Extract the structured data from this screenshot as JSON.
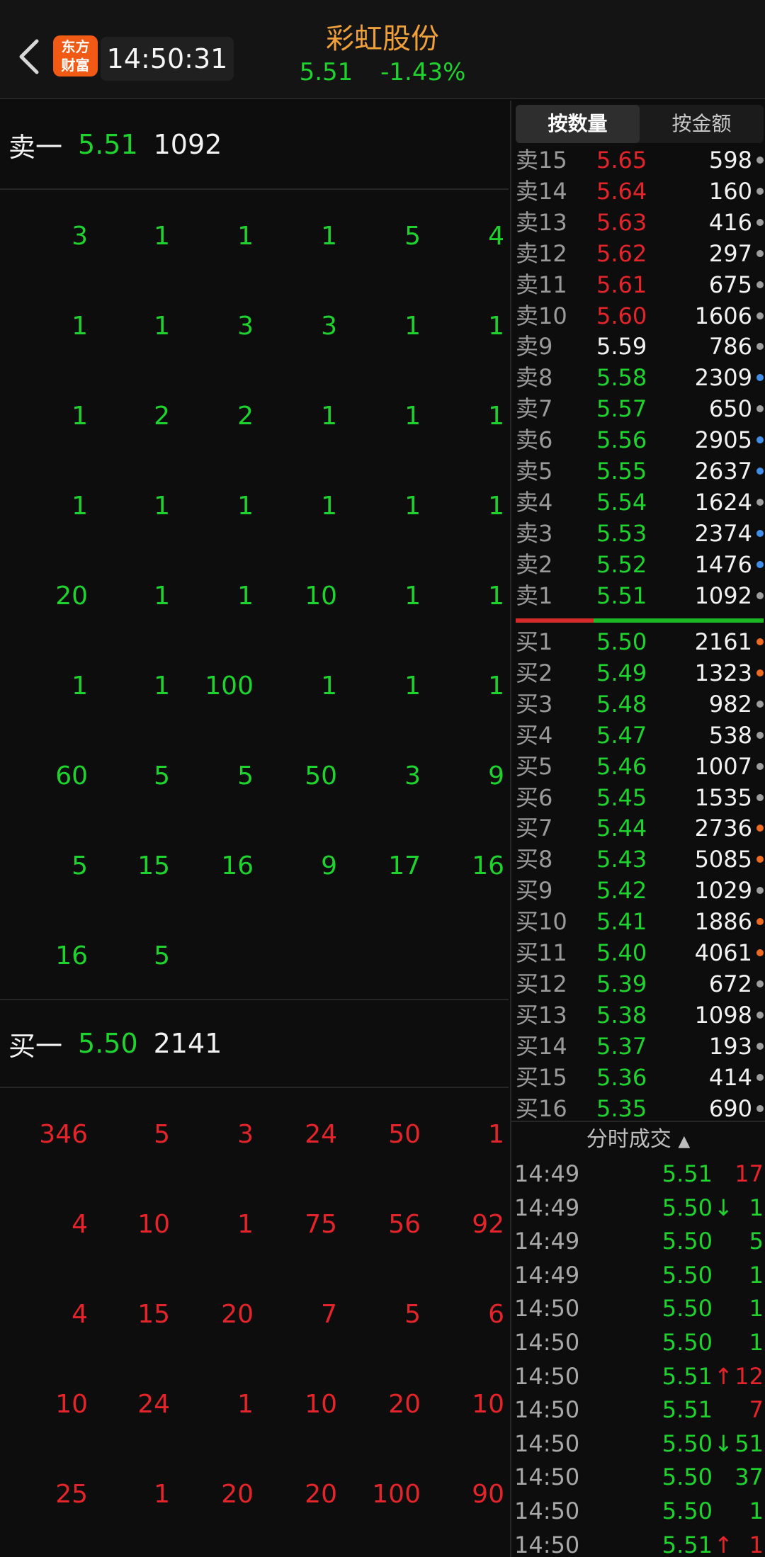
{
  "header": {
    "back_icon": "chevron-left-icon",
    "logo_line1": "东方",
    "logo_line2": "财富",
    "time": "14:50:31",
    "title": "彩虹股份",
    "price": "5.51",
    "change": "-1.43%"
  },
  "sell_queue": {
    "label": "卖一",
    "price": "5.51",
    "volume": "1092",
    "rows": [
      [
        "3",
        "1",
        "1",
        "1",
        "5",
        "4"
      ],
      [
        "1",
        "1",
        "3",
        "3",
        "1",
        "1"
      ],
      [
        "1",
        "2",
        "2",
        "1",
        "1",
        "1"
      ],
      [
        "1",
        "1",
        "1",
        "1",
        "1",
        "1"
      ],
      [
        "20",
        "1",
        "1",
        "10",
        "1",
        "1"
      ],
      [
        "1",
        "1",
        "100",
        "1",
        "1",
        "1"
      ],
      [
        "60",
        "5",
        "5",
        "50",
        "3",
        "9"
      ],
      [
        "5",
        "15",
        "16",
        "9",
        "17",
        "16"
      ],
      [
        "16",
        "5"
      ]
    ]
  },
  "buy_queue": {
    "label": "买一",
    "price": "5.50",
    "volume": "2141",
    "rows": [
      [
        "346",
        "5",
        "3",
        "24",
        "50",
        "1"
      ],
      [
        "4",
        "10",
        "1",
        "75",
        "56",
        "92"
      ],
      [
        "4",
        "15",
        "20",
        "7",
        "5",
        "6"
      ],
      [
        "10",
        "24",
        "1",
        "10",
        "20",
        "10"
      ],
      [
        "25",
        "1",
        "20",
        "20",
        "100",
        "90"
      ]
    ]
  },
  "tabs": [
    "按数量",
    "按金额"
  ],
  "sell_book": [
    {
      "label": "卖15",
      "price": "5.65",
      "vol": "598",
      "color": "red",
      "dot": "gray"
    },
    {
      "label": "卖14",
      "price": "5.64",
      "vol": "160",
      "color": "red",
      "dot": "gray"
    },
    {
      "label": "卖13",
      "price": "5.63",
      "vol": "416",
      "color": "red",
      "dot": "gray"
    },
    {
      "label": "卖12",
      "price": "5.62",
      "vol": "297",
      "color": "red",
      "dot": "gray"
    },
    {
      "label": "卖11",
      "price": "5.61",
      "vol": "675",
      "color": "red",
      "dot": "gray"
    },
    {
      "label": "卖10",
      "price": "5.60",
      "vol": "1606",
      "color": "red",
      "dot": "gray"
    },
    {
      "label": "卖9",
      "price": "5.59",
      "vol": "786",
      "color": "white",
      "dot": "gray"
    },
    {
      "label": "卖8",
      "price": "5.58",
      "vol": "2309",
      "color": "green",
      "dot": "blue"
    },
    {
      "label": "卖7",
      "price": "5.57",
      "vol": "650",
      "color": "green",
      "dot": "gray"
    },
    {
      "label": "卖6",
      "price": "5.56",
      "vol": "2905",
      "color": "green",
      "dot": "blue"
    },
    {
      "label": "卖5",
      "price": "5.55",
      "vol": "2637",
      "color": "green",
      "dot": "blue"
    },
    {
      "label": "卖4",
      "price": "5.54",
      "vol": "1624",
      "color": "green",
      "dot": "gray"
    },
    {
      "label": "卖3",
      "price": "5.53",
      "vol": "2374",
      "color": "green",
      "dot": "blue"
    },
    {
      "label": "卖2",
      "price": "5.52",
      "vol": "1476",
      "color": "green",
      "dot": "blue"
    },
    {
      "label": "卖1",
      "price": "5.51",
      "vol": "1092",
      "color": "green",
      "dot": "gray"
    }
  ],
  "buy_book": [
    {
      "label": "买1",
      "price": "5.50",
      "vol": "2161",
      "color": "green",
      "dot": "orange"
    },
    {
      "label": "买2",
      "price": "5.49",
      "vol": "1323",
      "color": "green",
      "dot": "orange"
    },
    {
      "label": "买3",
      "price": "5.48",
      "vol": "982",
      "color": "green",
      "dot": "gray"
    },
    {
      "label": "买4",
      "price": "5.47",
      "vol": "538",
      "color": "green",
      "dot": "gray"
    },
    {
      "label": "买5",
      "price": "5.46",
      "vol": "1007",
      "color": "green",
      "dot": "gray"
    },
    {
      "label": "买6",
      "price": "5.45",
      "vol": "1535",
      "color": "green",
      "dot": "gray"
    },
    {
      "label": "买7",
      "price": "5.44",
      "vol": "2736",
      "color": "green",
      "dot": "orange"
    },
    {
      "label": "买8",
      "price": "5.43",
      "vol": "5085",
      "color": "green",
      "dot": "orange"
    },
    {
      "label": "买9",
      "price": "5.42",
      "vol": "1029",
      "color": "green",
      "dot": "gray"
    },
    {
      "label": "买10",
      "price": "5.41",
      "vol": "1886",
      "color": "green",
      "dot": "orange"
    },
    {
      "label": "买11",
      "price": "5.40",
      "vol": "4061",
      "color": "green",
      "dot": "orange"
    },
    {
      "label": "买12",
      "price": "5.39",
      "vol": "672",
      "color": "green",
      "dot": "gray"
    },
    {
      "label": "买13",
      "price": "5.38",
      "vol": "1098",
      "color": "green",
      "dot": "gray"
    },
    {
      "label": "买14",
      "price": "5.37",
      "vol": "193",
      "color": "green",
      "dot": "gray"
    },
    {
      "label": "买15",
      "price": "5.36",
      "vol": "414",
      "color": "green",
      "dot": "gray"
    },
    {
      "label": "买16",
      "price": "5.35",
      "vol": "690",
      "color": "green",
      "dot": "gray"
    }
  ],
  "trades_header": "分时成交",
  "trades_header_icon": "triangle-up-icon",
  "trades": [
    {
      "time": "14:49",
      "price": "5.51",
      "arrow": "",
      "vol": "17",
      "vcolor": "red"
    },
    {
      "time": "14:49",
      "price": "5.50",
      "arrow": "↓",
      "vol": "1",
      "vcolor": "green"
    },
    {
      "time": "14:49",
      "price": "5.50",
      "arrow": "",
      "vol": "5",
      "vcolor": "green"
    },
    {
      "time": "14:49",
      "price": "5.50",
      "arrow": "",
      "vol": "1",
      "vcolor": "green"
    },
    {
      "time": "14:50",
      "price": "5.50",
      "arrow": "",
      "vol": "1",
      "vcolor": "green"
    },
    {
      "time": "14:50",
      "price": "5.50",
      "arrow": "",
      "vol": "1",
      "vcolor": "green"
    },
    {
      "time": "14:50",
      "price": "5.51",
      "arrow": "↑",
      "vol": "12",
      "vcolor": "red"
    },
    {
      "time": "14:50",
      "price": "5.51",
      "arrow": "",
      "vol": "7",
      "vcolor": "red"
    },
    {
      "time": "14:50",
      "price": "5.50",
      "arrow": "↓",
      "vol": "51",
      "vcolor": "green"
    },
    {
      "time": "14:50",
      "price": "5.50",
      "arrow": "",
      "vol": "37",
      "vcolor": "green"
    },
    {
      "time": "14:50",
      "price": "5.50",
      "arrow": "",
      "vol": "1",
      "vcolor": "green"
    },
    {
      "time": "14:50",
      "price": "5.51",
      "arrow": "↑",
      "vol": "1",
      "vcolor": "red"
    }
  ],
  "colors": {
    "up": "#e3252b",
    "down": "#1fd32f",
    "title": "#f0a03a"
  }
}
